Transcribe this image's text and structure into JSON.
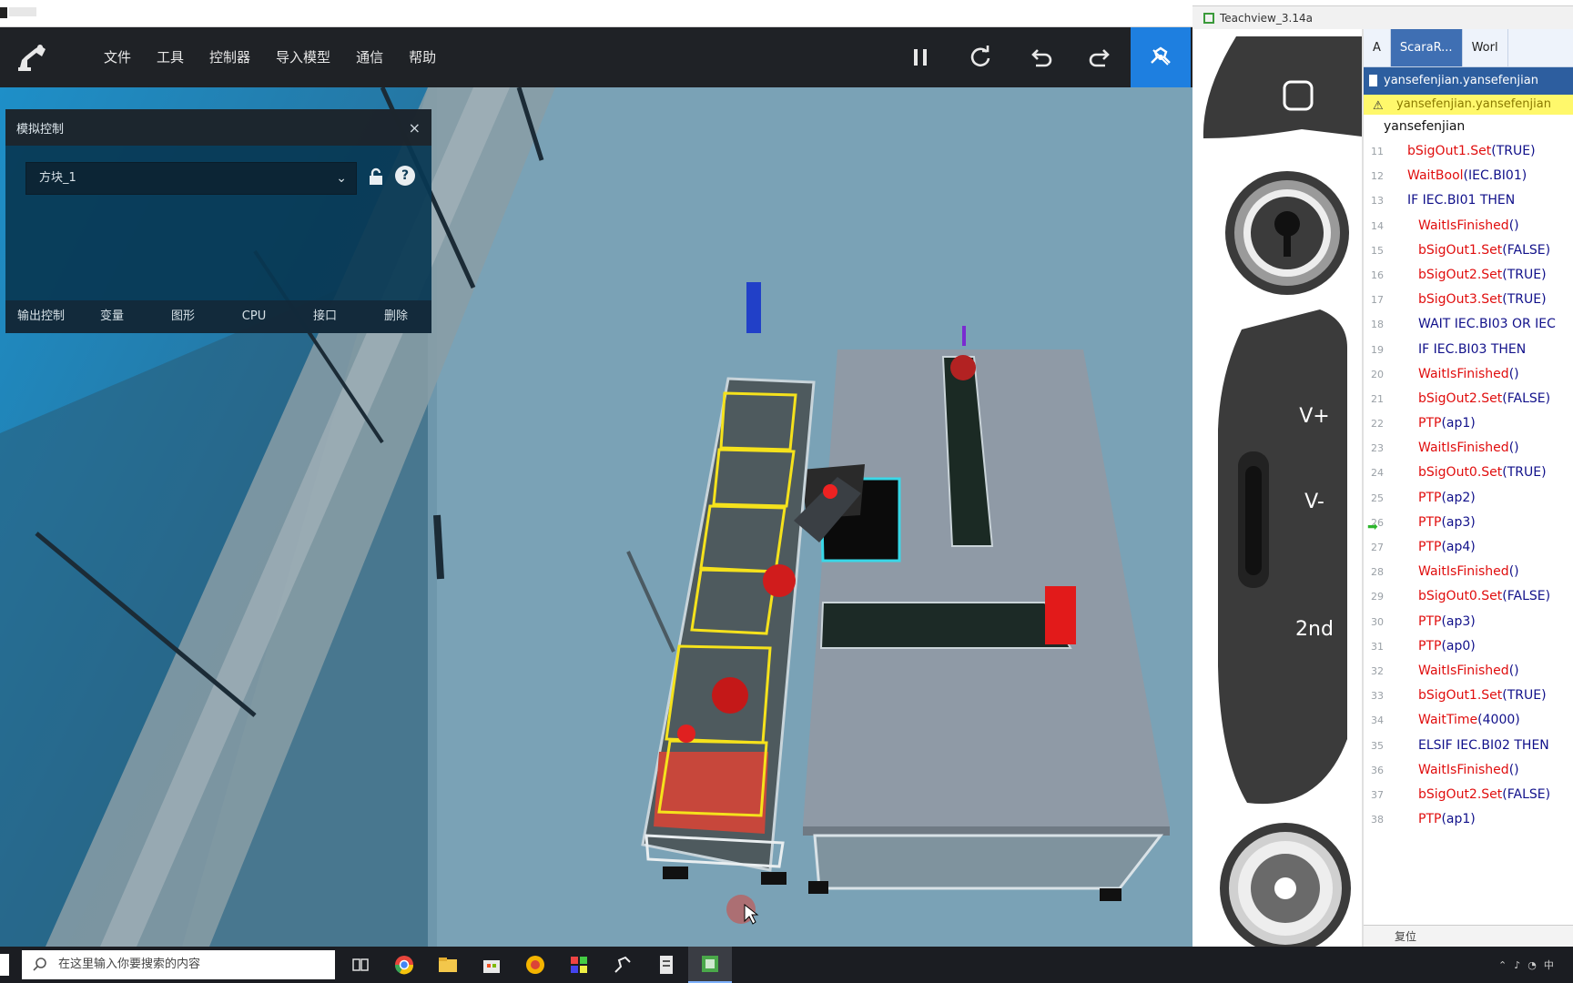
{
  "toolbar": {
    "menu": [
      "文件",
      "工具",
      "控制器",
      "导入模型",
      "通信",
      "帮助"
    ]
  },
  "panel": {
    "title": "模拟控制",
    "close": "×",
    "selected_object": "方块_1",
    "tabs": [
      "输出控制",
      "变量",
      "图形",
      "CPU",
      "接口",
      "删除"
    ]
  },
  "teachview": {
    "title": "Teachview_3.14a",
    "tabs": [
      "A",
      "ScaraR...",
      "Worl"
    ],
    "path": "yansefenjian.yansefenjian",
    "warning": "yansefenjian.yansefenjian",
    "program": "yansefenjian",
    "lines": [
      {
        "n": "11",
        "indent": 1,
        "parts": [
          [
            "r",
            "bSigOut1.Set"
          ],
          [
            "b",
            "(TRUE)"
          ]
        ]
      },
      {
        "n": "12",
        "indent": 1,
        "parts": [
          [
            "r",
            "WaitBool"
          ],
          [
            "b",
            "(IEC.BI01)"
          ]
        ]
      },
      {
        "n": "13",
        "indent": 1,
        "parts": [
          [
            "b",
            "IF IEC.BI01 THEN"
          ]
        ]
      },
      {
        "n": "14",
        "indent": 2,
        "parts": [
          [
            "r",
            "WaitIsFinished"
          ],
          [
            "b",
            "()"
          ]
        ]
      },
      {
        "n": "15",
        "indent": 2,
        "parts": [
          [
            "r",
            "bSigOut1.Set"
          ],
          [
            "b",
            "(FALSE)"
          ]
        ]
      },
      {
        "n": "16",
        "indent": 2,
        "parts": [
          [
            "r",
            "bSigOut2.Set"
          ],
          [
            "b",
            "(TRUE)"
          ]
        ]
      },
      {
        "n": "17",
        "indent": 2,
        "parts": [
          [
            "r",
            "bSigOut3.Set"
          ],
          [
            "b",
            "(TRUE)"
          ]
        ]
      },
      {
        "n": "18",
        "indent": 2,
        "parts": [
          [
            "b",
            "WAIT IEC.BI03 OR IEC"
          ]
        ]
      },
      {
        "n": "19",
        "indent": 2,
        "parts": [
          [
            "b",
            "IF IEC.BI03 THEN"
          ]
        ]
      },
      {
        "n": "20",
        "indent": 2,
        "parts": [
          [
            "r",
            "WaitIsFinished"
          ],
          [
            "b",
            "()"
          ]
        ]
      },
      {
        "n": "21",
        "indent": 2,
        "parts": [
          [
            "r",
            "bSigOut2.Set"
          ],
          [
            "b",
            "(FALSE)"
          ]
        ]
      },
      {
        "n": "22",
        "indent": 2,
        "parts": [
          [
            "r",
            "PTP"
          ],
          [
            "b",
            "(ap1)"
          ]
        ]
      },
      {
        "n": "23",
        "indent": 2,
        "parts": [
          [
            "r",
            "WaitIsFinished"
          ],
          [
            "b",
            "()"
          ]
        ]
      },
      {
        "n": "24",
        "indent": 2,
        "parts": [
          [
            "r",
            "bSigOut0.Set"
          ],
          [
            "b",
            "(TRUE)"
          ]
        ]
      },
      {
        "n": "25",
        "indent": 2,
        "parts": [
          [
            "r",
            "PTP"
          ],
          [
            "b",
            "(ap2)"
          ]
        ]
      },
      {
        "n": "26",
        "indent": 2,
        "current": true,
        "parts": [
          [
            "r",
            "PTP"
          ],
          [
            "b",
            "(ap3)"
          ]
        ]
      },
      {
        "n": "27",
        "indent": 2,
        "parts": [
          [
            "r",
            "PTP"
          ],
          [
            "b",
            "(ap4)"
          ]
        ]
      },
      {
        "n": "28",
        "indent": 2,
        "parts": [
          [
            "r",
            "WaitIsFinished"
          ],
          [
            "b",
            "()"
          ]
        ]
      },
      {
        "n": "29",
        "indent": 2,
        "parts": [
          [
            "r",
            "bSigOut0.Set"
          ],
          [
            "b",
            "(FALSE)"
          ]
        ]
      },
      {
        "n": "30",
        "indent": 2,
        "parts": [
          [
            "r",
            "PTP"
          ],
          [
            "b",
            "(ap3)"
          ]
        ]
      },
      {
        "n": "31",
        "indent": 2,
        "parts": [
          [
            "r",
            "PTP"
          ],
          [
            "b",
            "(ap0)"
          ]
        ]
      },
      {
        "n": "32",
        "indent": 2,
        "parts": [
          [
            "r",
            "WaitIsFinished"
          ],
          [
            "b",
            "()"
          ]
        ]
      },
      {
        "n": "33",
        "indent": 2,
        "parts": [
          [
            "r",
            "bSigOut1.Set"
          ],
          [
            "b",
            "(TRUE)"
          ]
        ]
      },
      {
        "n": "34",
        "indent": 2,
        "parts": [
          [
            "r",
            "WaitTime"
          ],
          [
            "b",
            "(4000)"
          ]
        ]
      },
      {
        "n": "35",
        "indent": 2,
        "parts": [
          [
            "b",
            "ELSIF IEC.BI02 THEN"
          ]
        ]
      },
      {
        "n": "36",
        "indent": 2,
        "parts": [
          [
            "r",
            "WaitIsFinished"
          ],
          [
            "b",
            "()"
          ]
        ]
      },
      {
        "n": "37",
        "indent": 2,
        "parts": [
          [
            "r",
            "bSigOut2.Set"
          ],
          [
            "b",
            "(FALSE)"
          ]
        ]
      },
      {
        "n": "38",
        "indent": 2,
        "parts": [
          [
            "r",
            "PTP"
          ],
          [
            "b",
            "(ap1)"
          ]
        ]
      }
    ],
    "footer": "复位",
    "pendant": {
      "v_plus": "V+",
      "v_minus": "V-",
      "second": "2nd"
    }
  },
  "taskbar": {
    "search_placeholder": "在这里输入你要搜索的内容"
  },
  "colors": {
    "toolbar_bg": "#1f2226",
    "active_button": "#1e7fe0",
    "code_keyword_red": "#e00d0d",
    "code_text_blue": "#10108a",
    "path_bar": "#2d5e9f",
    "warning_bar": "#fff86b"
  }
}
